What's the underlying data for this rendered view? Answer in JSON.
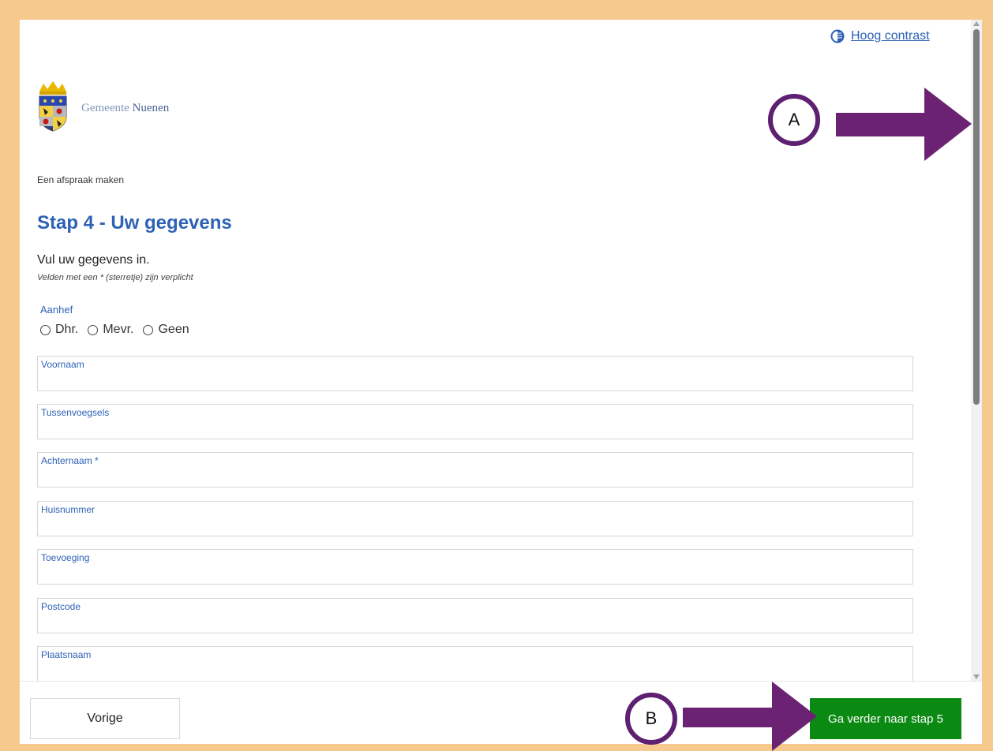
{
  "header": {
    "contrast_label": "Hoog contrast",
    "logo_text_light": "Gemeente",
    "logo_text_dark": "Nuenen"
  },
  "breadcrumb": "Een afspraak maken",
  "title": "Stap 4 - Uw gegevens",
  "intro": "Vul uw gegevens in.",
  "required_note": "Velden met een * (sterretje) zijn verplicht",
  "salutation": {
    "label": "Aanhef",
    "options": [
      "Dhr.",
      "Mevr.",
      "Geen"
    ]
  },
  "fields": [
    {
      "label": "Voornaam",
      "value": ""
    },
    {
      "label": "Tussenvoegsels",
      "value": ""
    },
    {
      "label": "Achternaam *",
      "value": ""
    },
    {
      "label": "Huisnummer",
      "value": ""
    },
    {
      "label": "Toevoeging",
      "value": ""
    },
    {
      "label": "Postcode",
      "value": ""
    },
    {
      "label": "Plaatsnaam",
      "value": ""
    }
  ],
  "footer": {
    "back_label": "Vorige",
    "next_label": "Ga verder naar stap 5"
  },
  "annotations": {
    "marker_a": "A",
    "marker_b": "B"
  },
  "colors": {
    "accent_blue": "#2e62b5",
    "next_button": "#0a8a12",
    "annotation_purple": "#6b2272",
    "frame": "#f6c98f"
  },
  "icons": [
    "contrast-icon",
    "coat-of-arms-logo",
    "arrow-right-icon"
  ]
}
